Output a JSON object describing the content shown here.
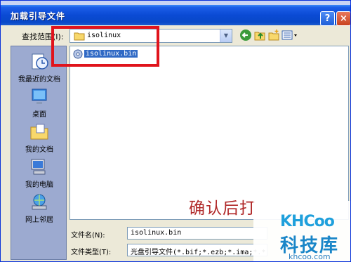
{
  "window": {
    "title": "加载引导文件",
    "help_label": "?",
    "close_label": "×"
  },
  "lookin": {
    "label": "查找范围(I):",
    "value": "isolinux"
  },
  "toolbar": {
    "back_icon": "back-arrow-icon",
    "up_icon": "up-folder-icon",
    "new_folder_icon": "new-folder-icon",
    "views_icon": "views-menu-icon"
  },
  "places": [
    {
      "label": "我最近的文档",
      "icon": "recent-documents-icon"
    },
    {
      "label": "桌面",
      "icon": "desktop-icon"
    },
    {
      "label": "我的文档",
      "icon": "my-documents-icon"
    },
    {
      "label": "我的电脑",
      "icon": "my-computer-icon"
    },
    {
      "label": "网上邻居",
      "icon": "network-places-icon"
    }
  ],
  "files": [
    {
      "name": "isolinux.bin",
      "icon": "disc-file-icon",
      "selected": true
    }
  ],
  "filename": {
    "label": "文件名(N):",
    "value": "isolinux.bin"
  },
  "filetype": {
    "label": "文件类型(T):",
    "value": "光盘引导文件(*.bif;*.ezb;*.ima;*.*)"
  },
  "overlay": {
    "caption": "确认后打",
    "watermark_logo": "KHCoo",
    "watermark_text": "科技库",
    "watermark_url": "khcoo.com"
  },
  "colors": {
    "highlight": "#e0141c",
    "selection": "#316ac5",
    "titlebar": "#0a4ad4"
  }
}
